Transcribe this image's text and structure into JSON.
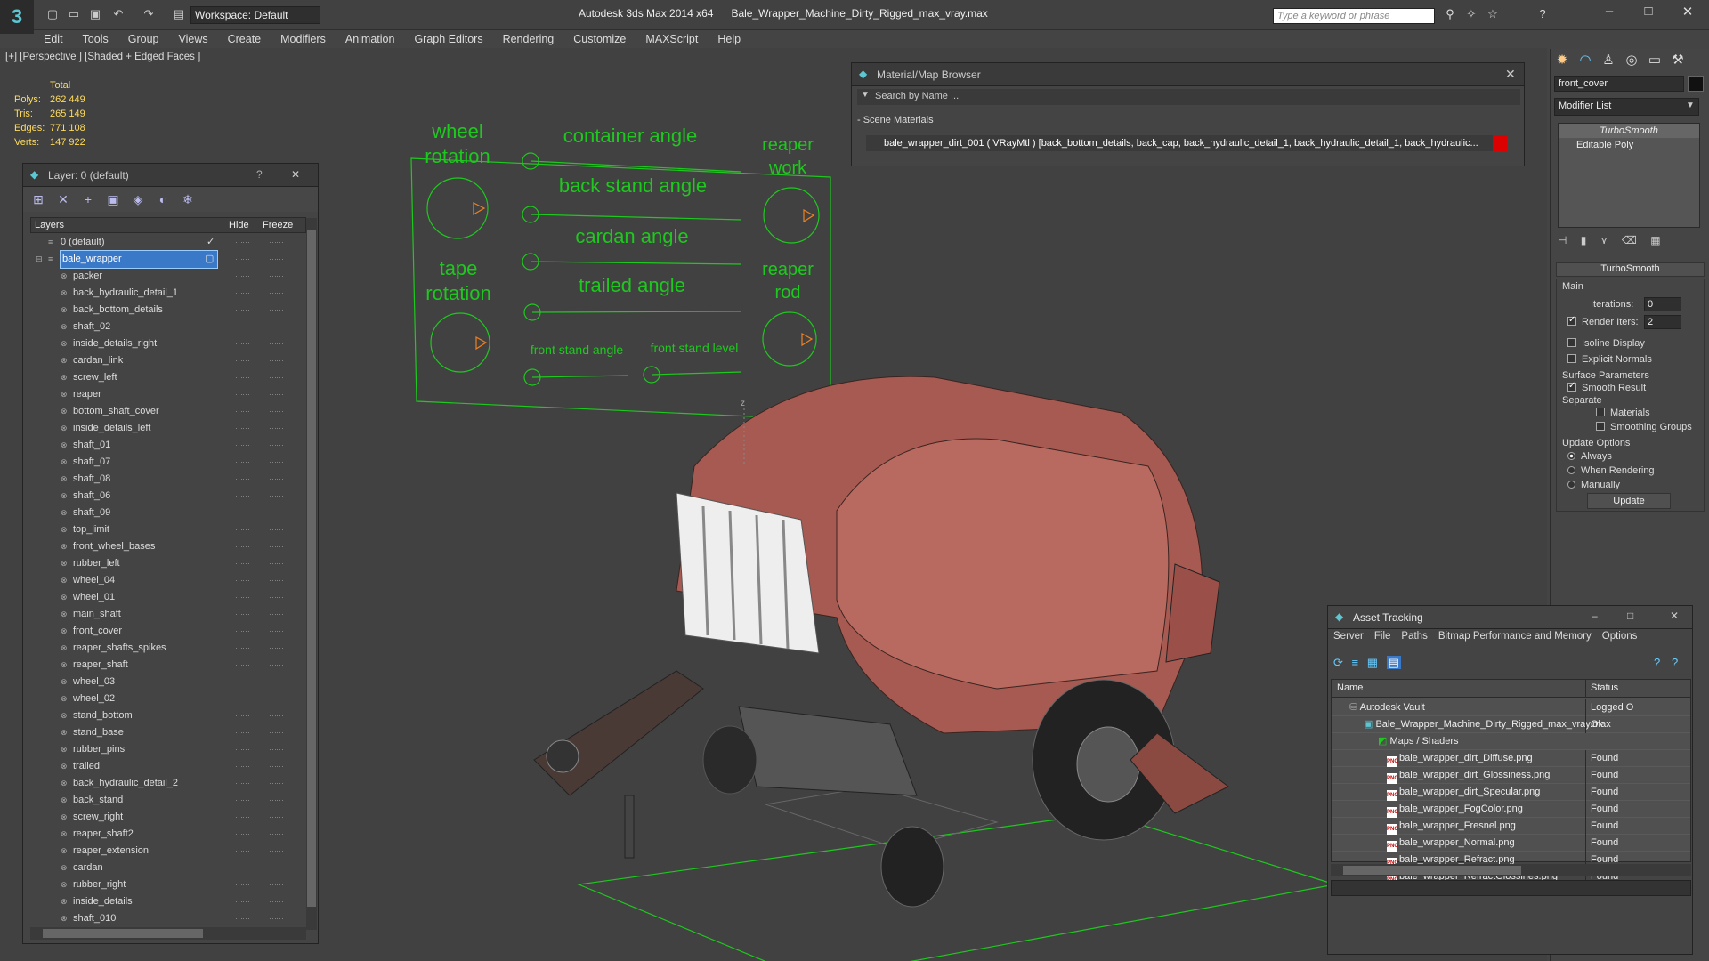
{
  "app": {
    "logo": "3",
    "title": "Autodesk 3ds Max  2014 x64",
    "file": "Bale_Wrapper_Machine_Dirty_Rigged_max_vray.max",
    "workspace": "Workspace: Default",
    "search_placeholder": "Type a keyword or phrase"
  },
  "menu": [
    "Edit",
    "Tools",
    "Group",
    "Views",
    "Create",
    "Modifiers",
    "Animation",
    "Graph Editors",
    "Rendering",
    "Customize",
    "MAXScript",
    "Help"
  ],
  "viewport": {
    "label": "[+] [Perspective ] [Shaded + Edged Faces ]",
    "stats": {
      "header": "Total",
      "polys_label": "Polys:",
      "polys": "262 449",
      "tris_label": "Tris:",
      "tris": "265 149",
      "edges_label": "Edges:",
      "edges": "771 108",
      "verts_label": "Verts:",
      "verts": "147 922"
    },
    "rig_labels": {
      "wheel_rotation": "wheel rotation",
      "container_angle": "container angle",
      "reaper_work": "reaper work",
      "back_stand_angle": "back stand angle",
      "cardan_angle": "cardan angle",
      "tape_rotation": "tape rotation",
      "trailed_angle": "trailed angle",
      "reaper_rod": "reaper rod",
      "front_stand_angle": "front stand angle",
      "front_stand_level": "front stand level"
    },
    "axis_label": "z"
  },
  "layer_panel": {
    "title": "Layer: 0 (default)",
    "help": "?",
    "close": "✕",
    "col_layers": "Layers",
    "col_hide": "Hide",
    "col_freeze": "Freeze",
    "default_layer": "0 (default)",
    "selected_layer": "bale_wrapper",
    "objects": [
      "packer",
      "back_hydraulic_detail_1",
      "back_bottom_details",
      "shaft_02",
      "inside_details_right",
      "cardan_link",
      "screw_left",
      "reaper",
      "bottom_shaft_cover",
      "inside_details_left",
      "shaft_01",
      "shaft_07",
      "shaft_08",
      "shaft_06",
      "shaft_09",
      "top_limit",
      "front_wheel_bases",
      "rubber_left",
      "wheel_04",
      "wheel_01",
      "main_shaft",
      "front_cover",
      "reaper_shafts_spikes",
      "reaper_shaft",
      "wheel_03",
      "wheel_02",
      "stand_bottom",
      "stand_base",
      "rubber_pins",
      "trailed",
      "back_hydraulic_detail_2",
      "back_stand",
      "screw_right",
      "reaper_shaft2",
      "reaper_extension",
      "cardan",
      "rubber_right",
      "inside_details",
      "shaft_010"
    ],
    "dash": "⋯⋯"
  },
  "material_browser": {
    "title": "Material/Map Browser",
    "search": "Search by Name ...",
    "section": "- Scene Materials",
    "material": "bale_wrapper_dirt_001 ( VRayMtl ) [back_bottom_details, back_cap, back_hydraulic_detail_1, back_hydraulic_detail_1, back_hydraulic..."
  },
  "command_panel": {
    "object_name": "front_cover",
    "modifier_list": "Modifier List",
    "stack": [
      "TurboSmooth",
      "Editable Poly"
    ],
    "rollout": "TurboSmooth",
    "main": "Main",
    "iterations_label": "Iterations:",
    "iterations": "0",
    "render_iters_label": "Render Iters:",
    "render_iters": "2",
    "isoline": "Isoline Display",
    "explicit_normals": "Explicit Normals",
    "surface_params": "Surface Parameters",
    "smooth_result": "Smooth Result",
    "separate": "Separate",
    "materials": "Materials",
    "smoothing_groups": "Smoothing Groups",
    "update_options": "Update Options",
    "always": "Always",
    "when_rendering": "When Rendering",
    "manually": "Manually",
    "update_btn": "Update"
  },
  "asset_tracking": {
    "title": "Asset Tracking",
    "menu": [
      "Server",
      "File",
      "Paths",
      "Bitmap Performance and Memory",
      "Options"
    ],
    "col_name": "Name",
    "col_status": "Status",
    "vault": "Autodesk Vault",
    "vault_status": "Logged O",
    "file": "Bale_Wrapper_Machine_Dirty_Rigged_max_vray.max",
    "file_status": "Ok",
    "maps": "Maps / Shaders",
    "png": "PNG",
    "textures": [
      {
        "name": "bale_wrapper_dirt_Diffuse.png",
        "status": "Found"
      },
      {
        "name": "bale_wrapper_dirt_Glossiness.png",
        "status": "Found"
      },
      {
        "name": "bale_wrapper_dirt_Specular.png",
        "status": "Found"
      },
      {
        "name": "bale_wrapper_FogColor.png",
        "status": "Found"
      },
      {
        "name": "bale_wrapper_Fresnel.png",
        "status": "Found"
      },
      {
        "name": "bale_wrapper_Normal.png",
        "status": "Found"
      },
      {
        "name": "bale_wrapper_Refract.png",
        "status": "Found"
      },
      {
        "name": "bale_wrapper_RefractGlossines.png",
        "status": "Found"
      }
    ]
  },
  "colors": {
    "rig_green": "#1ec81e",
    "machine_red": "#b45a50",
    "selection_blue": "#3a78c8",
    "stats_yellow": "#ffdb5a"
  }
}
